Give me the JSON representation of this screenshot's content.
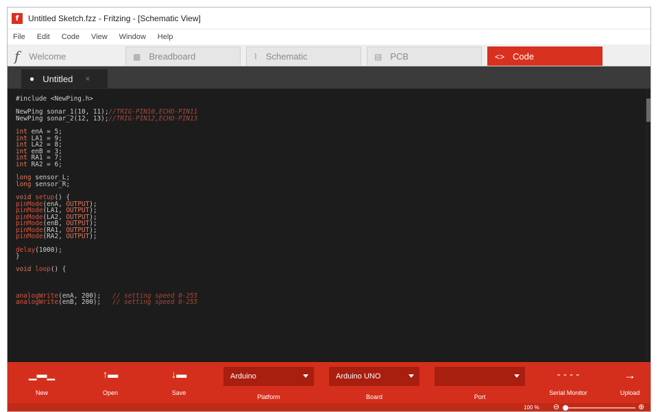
{
  "window": {
    "title": "Untitled Sketch.fzz - Fritzing - [Schematic View]",
    "icon_letter": "f"
  },
  "menu": [
    "File",
    "Edit",
    "Code",
    "View",
    "Window",
    "Help"
  ],
  "view_tabs": [
    {
      "label": "Welcome",
      "icon": "fritzing-logo-icon",
      "active": false
    },
    {
      "label": "Breadboard",
      "icon": "breadboard-icon",
      "active": false
    },
    {
      "label": "Schematic",
      "icon": "schematic-icon",
      "active": false
    },
    {
      "label": "PCB",
      "icon": "pcb-icon",
      "active": false
    },
    {
      "label": "Code",
      "icon": "code-icon",
      "active": true
    }
  ],
  "file_tab": {
    "label": "Untitled",
    "close_glyph": "×"
  },
  "code_lines": [
    [
      [
        "ct",
        "#include <NewPing.h>"
      ]
    ],
    [],
    [
      [
        "ct",
        "NewPing sonar_1(10, 11);"
      ],
      [
        "cm",
        "//TRIG-PIN10,ECHO-PIN11"
      ]
    ],
    [
      [
        "ct",
        "NewPing sonar_2(12, 13);"
      ],
      [
        "cm",
        "//TRIG-PIN12,ECHO-PIN13"
      ]
    ],
    [],
    [
      [
        "kw",
        "int"
      ],
      [
        "ct",
        " enA = 5;"
      ]
    ],
    [
      [
        "kw",
        "int"
      ],
      [
        "ct",
        " LA1 = 9;"
      ]
    ],
    [
      [
        "kw",
        "int"
      ],
      [
        "ct",
        " LA2 = 8;"
      ]
    ],
    [
      [
        "kw",
        "int"
      ],
      [
        "ct",
        " enB = 3;"
      ]
    ],
    [
      [
        "kw",
        "int"
      ],
      [
        "ct",
        " RA1 = 7;"
      ]
    ],
    [
      [
        "kw",
        "int"
      ],
      [
        "ct",
        " RA2 = 6;"
      ]
    ],
    [],
    [
      [
        "kw",
        "long"
      ],
      [
        "ct",
        " sensor_L;"
      ]
    ],
    [
      [
        "kw",
        "long"
      ],
      [
        "ct",
        " sensor_R;"
      ]
    ],
    [],
    [
      [
        "kw",
        "void"
      ],
      [
        "ct",
        " "
      ],
      [
        "fn",
        "setup"
      ],
      [
        "ct",
        "() {"
      ]
    ],
    [
      [
        "fn",
        "pinMode"
      ],
      [
        "ct",
        "(enA, "
      ],
      [
        "kw",
        "OUTPUT"
      ],
      [
        "ct",
        ");"
      ]
    ],
    [
      [
        "fn",
        "pinMode"
      ],
      [
        "ct",
        "(LA1, "
      ],
      [
        "kw",
        "OUTPUT"
      ],
      [
        "ct",
        ");"
      ]
    ],
    [
      [
        "fn",
        "pinMode"
      ],
      [
        "ct",
        "(LA2, "
      ],
      [
        "kw",
        "OUTPUT"
      ],
      [
        "ct",
        ");"
      ]
    ],
    [
      [
        "fn",
        "pinMode"
      ],
      [
        "ct",
        "(enB, "
      ],
      [
        "kw",
        "OUTPUT"
      ],
      [
        "ct",
        ");"
      ]
    ],
    [
      [
        "fn",
        "pinMode"
      ],
      [
        "ct",
        "(RA1, "
      ],
      [
        "kw",
        "OUTPUT"
      ],
      [
        "ct",
        ");"
      ]
    ],
    [
      [
        "fn",
        "pinMode"
      ],
      [
        "ct",
        "(RA2, "
      ],
      [
        "kw",
        "OUTPUT"
      ],
      [
        "ct",
        ");"
      ]
    ],
    [],
    [
      [
        "fn",
        "delay"
      ],
      [
        "ct",
        "(1000);"
      ]
    ],
    [
      [
        "ct",
        "}"
      ]
    ],
    [],
    [
      [
        "kw",
        "void"
      ],
      [
        "ct",
        " "
      ],
      [
        "fn",
        "loop"
      ],
      [
        "ct",
        "() {"
      ]
    ],
    [],
    [],
    [],
    [
      [
        "fn",
        "analogWrite"
      ],
      [
        "ct",
        "(enA, 200);   "
      ],
      [
        "cm",
        "// setting speed 0-255"
      ]
    ],
    [
      [
        "fn",
        "analogWrite"
      ],
      [
        "ct",
        "(enB, 200);   "
      ],
      [
        "cm",
        "// setting speed 0-255"
      ]
    ]
  ],
  "toolbar": {
    "new_label": "New",
    "open_label": "Open",
    "save_label": "Save",
    "platform": {
      "value": "Arduino",
      "label": "Platform"
    },
    "board": {
      "value": "Arduino UNO",
      "label": "Board"
    },
    "port": {
      "value": "",
      "label": "Port"
    },
    "serial_monitor_label": "Serial Monitor",
    "upload_label": "Upload"
  },
  "status": {
    "zoom_text": "100 %",
    "zoom_level_percent": 100
  },
  "colors": {
    "accent": "#d42f1c",
    "editor_bg": "#1c1c1c",
    "keyword": "#e3765a",
    "comment": "#a84a36"
  }
}
